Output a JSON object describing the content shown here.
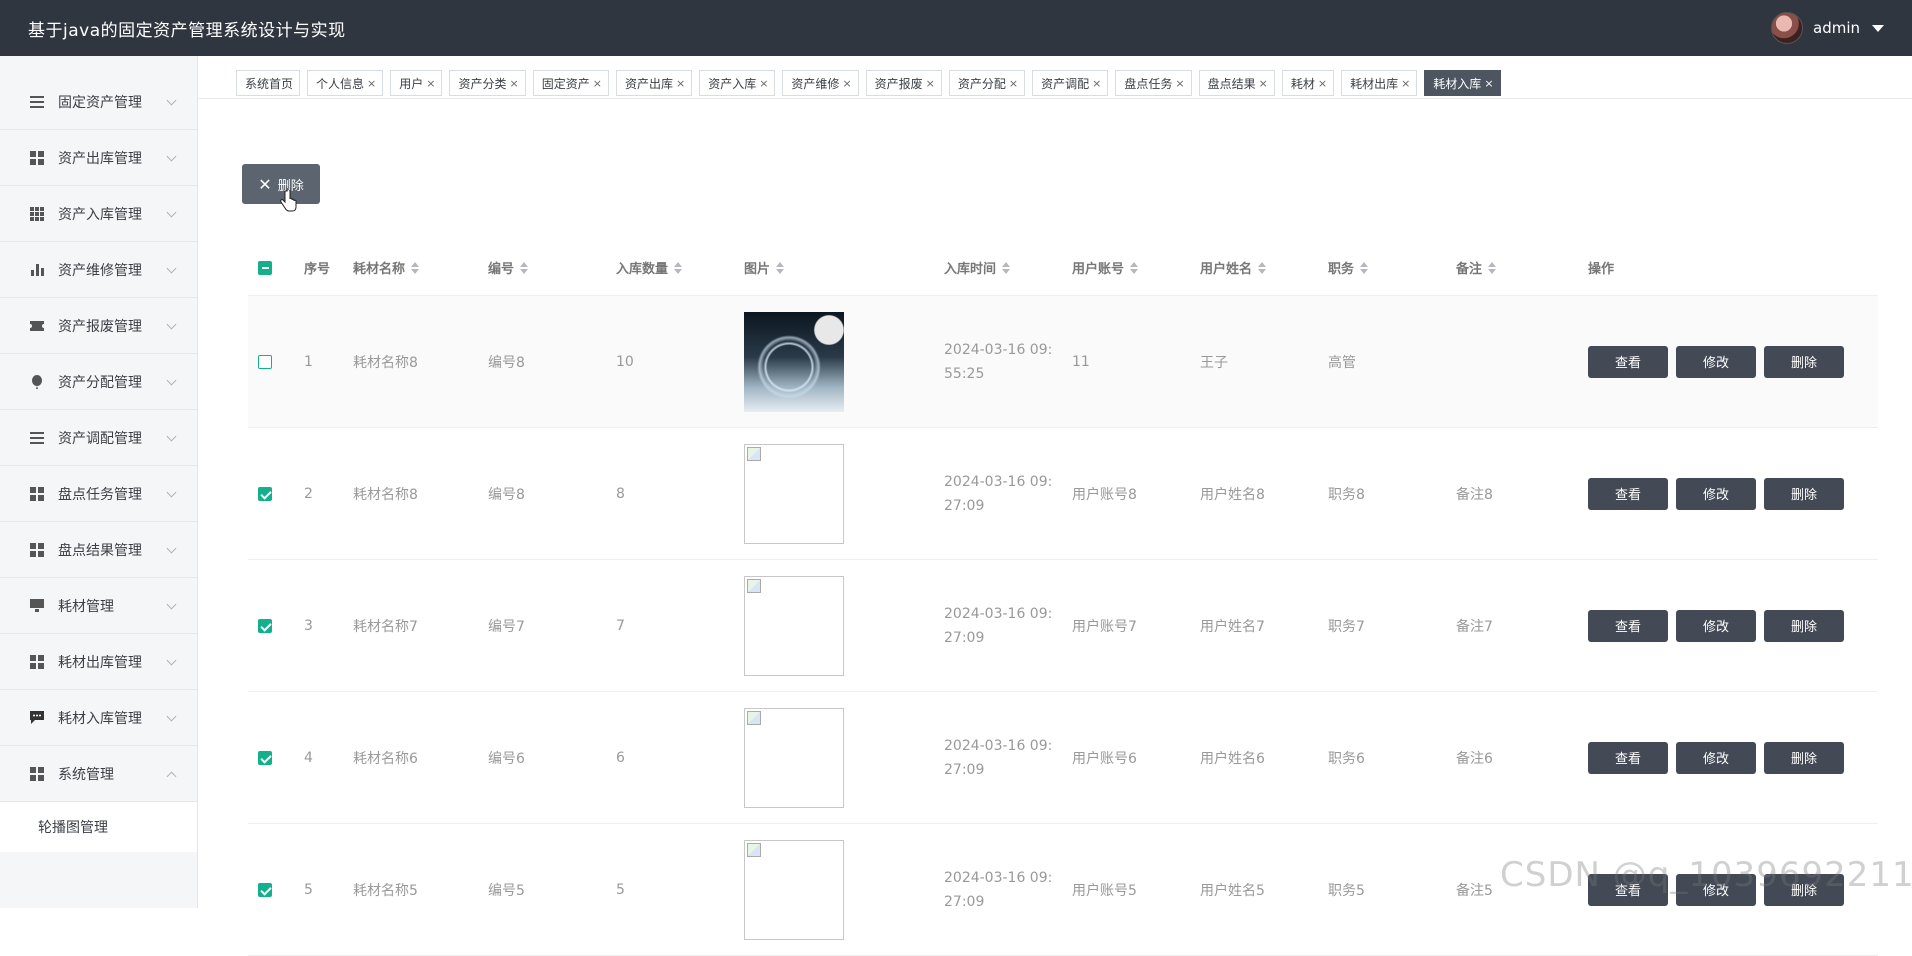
{
  "header": {
    "title": "基于java的固定资产管理系统设计与实现",
    "username": "admin"
  },
  "sidebar": {
    "items": [
      {
        "label": "固定资产管理",
        "icon": "list-icon"
      },
      {
        "label": "资产出库管理",
        "icon": "grid-icon"
      },
      {
        "label": "资产入库管理",
        "icon": "grid9-icon"
      },
      {
        "label": "资产维修管理",
        "icon": "bar-chart-icon"
      },
      {
        "label": "资产报废管理",
        "icon": "ticket-icon"
      },
      {
        "label": "资产分配管理",
        "icon": "balloon-icon"
      },
      {
        "label": "资产调配管理",
        "icon": "list-icon"
      },
      {
        "label": "盘点任务管理",
        "icon": "grid-icon"
      },
      {
        "label": "盘点结果管理",
        "icon": "grid-icon"
      },
      {
        "label": "耗材管理",
        "icon": "monitor-icon"
      },
      {
        "label": "耗材出库管理",
        "icon": "grid-icon"
      },
      {
        "label": "耗材入库管理",
        "icon": "chat-icon"
      },
      {
        "label": "系统管理",
        "icon": "grid-icon"
      }
    ],
    "submenu": "轮播图管理"
  },
  "tabs": [
    {
      "label": "系统首页",
      "closable": false
    },
    {
      "label": "个人信息",
      "closable": true
    },
    {
      "label": "用户",
      "closable": true
    },
    {
      "label": "资产分类",
      "closable": true
    },
    {
      "label": "固定资产",
      "closable": true
    },
    {
      "label": "资产出库",
      "closable": true
    },
    {
      "label": "资产入库",
      "closable": true
    },
    {
      "label": "资产维修",
      "closable": true
    },
    {
      "label": "资产报废",
      "closable": true
    },
    {
      "label": "资产分配",
      "closable": true
    },
    {
      "label": "资产调配",
      "closable": true
    },
    {
      "label": "盘点任务",
      "closable": true
    },
    {
      "label": "盘点结果",
      "closable": true
    },
    {
      "label": "耗材",
      "closable": true
    },
    {
      "label": "耗材出库",
      "closable": true
    },
    {
      "label": "耗材入库",
      "closable": true,
      "active": true
    }
  ],
  "close_glyph": "×",
  "toolbar": {
    "delete_label": "删除"
  },
  "table": {
    "headers": [
      "序号",
      "耗材名称",
      "编号",
      "入库数量",
      "图片",
      "入库时间",
      "用户账号",
      "用户姓名",
      "职务",
      "备注",
      "操作"
    ],
    "rows": [
      {
        "idx": "1",
        "name": "耗材名称8",
        "code": "编号8",
        "qty": "10",
        "time1": "2024-03-16 09:",
        "time2": "55:25",
        "account": "11",
        "uname": "王子",
        "position": "高管",
        "note": "",
        "checked": false,
        "photo": true
      },
      {
        "idx": "2",
        "name": "耗材名称8",
        "code": "编号8",
        "qty": "8",
        "time1": "2024-03-16 09:",
        "time2": "27:09",
        "account": "用户账号8",
        "uname": "用户姓名8",
        "position": "职务8",
        "note": "备注8",
        "checked": true,
        "photo": false
      },
      {
        "idx": "3",
        "name": "耗材名称7",
        "code": "编号7",
        "qty": "7",
        "time1": "2024-03-16 09:",
        "time2": "27:09",
        "account": "用户账号7",
        "uname": "用户姓名7",
        "position": "职务7",
        "note": "备注7",
        "checked": true,
        "photo": false
      },
      {
        "idx": "4",
        "name": "耗材名称6",
        "code": "编号6",
        "qty": "6",
        "time1": "2024-03-16 09:",
        "time2": "27:09",
        "account": "用户账号6",
        "uname": "用户姓名6",
        "position": "职务6",
        "note": "备注6",
        "checked": true,
        "photo": false
      },
      {
        "idx": "5",
        "name": "耗材名称5",
        "code": "编号5",
        "qty": "5",
        "time1": "2024-03-16 09:",
        "time2": "27:09",
        "account": "用户账号5",
        "uname": "用户姓名5",
        "position": "职务5",
        "note": "备注5",
        "checked": true,
        "photo": false
      }
    ],
    "actions": {
      "view": "查看",
      "edit": "修改",
      "delete": "删除"
    }
  },
  "watermark": "CSDN @q_1039692211",
  "colors": {
    "accent": "#13b08b",
    "header_bg": "#2f3640",
    "button_bg": "#434a55"
  }
}
